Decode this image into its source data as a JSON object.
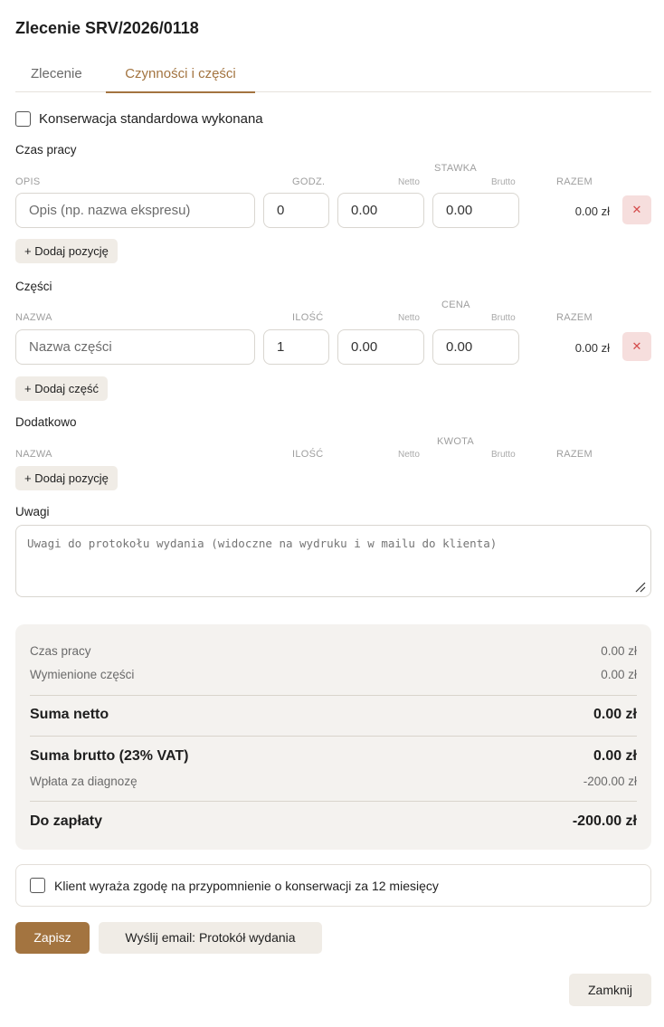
{
  "title": "Zlecenie SRV/2026/0118",
  "tabs": [
    {
      "label": "Zlecenie",
      "active": false
    },
    {
      "label": "Czynności i części",
      "active": true
    }
  ],
  "maintenance_checkbox": {
    "label": "Konserwacja standardowa wykonana",
    "checked": false
  },
  "labor": {
    "section_label": "Czas pracy",
    "headers": {
      "desc": "OPIS",
      "qty": "GODZ.",
      "group": "STAWKA",
      "net": "Netto",
      "gross": "Brutto",
      "total": "RAZEM"
    },
    "row": {
      "desc_placeholder": "Opis (np. nazwa ekspresu)",
      "qty": "0",
      "net": "0.00",
      "gross": "0.00",
      "total": "0.00 zł"
    },
    "add_label": "+ Dodaj pozycję"
  },
  "parts": {
    "section_label": "Części",
    "headers": {
      "desc": "NAZWA",
      "qty": "ILOŚĆ",
      "group": "CENA",
      "net": "Netto",
      "gross": "Brutto",
      "total": "RAZEM"
    },
    "row": {
      "desc_placeholder": "Nazwa części",
      "qty": "1",
      "net": "0.00",
      "gross": "0.00",
      "total": "0.00 zł"
    },
    "add_label": "+ Dodaj część"
  },
  "extra": {
    "section_label": "Dodatkowo",
    "headers": {
      "desc": "NAZWA",
      "qty": "ILOŚĆ",
      "group": "KWOTA",
      "net": "Netto",
      "gross": "Brutto",
      "total": "RAZEM"
    },
    "add_label": "+ Dodaj pozycję"
  },
  "notes": {
    "label": "Uwagi",
    "placeholder": "Uwagi do protokołu wydania (widoczne na wydruku i w mailu do klienta)"
  },
  "summary": {
    "labor_label": "Czas pracy",
    "labor_value": "0.00 zł",
    "parts_label": "Wymienione części",
    "parts_value": "0.00 zł",
    "net_label": "Suma netto",
    "net_value": "0.00 zł",
    "gross_label": "Suma brutto (23% VAT)",
    "gross_value": "0.00 zł",
    "deposit_label": "Wpłata za diagnozę",
    "deposit_value": "-200.00 zł",
    "due_label": "Do zapłaty",
    "due_value": "-200.00 zł"
  },
  "consent": {
    "label": "Klient wyraża zgodę na przypomnienie o konserwacji za 12 miesięcy",
    "checked": false
  },
  "buttons": {
    "save": "Zapisz",
    "send_email": "Wyślij email: Protokół wydania",
    "close": "Zamknij"
  },
  "icons": {
    "delete": "close-icon",
    "resize": "resize-grip-icon"
  },
  "colors": {
    "accent": "#a37440",
    "delete_bg": "#f6dedd",
    "delete_fg": "#d44b4b",
    "summary_bg": "#f4f2ef"
  }
}
